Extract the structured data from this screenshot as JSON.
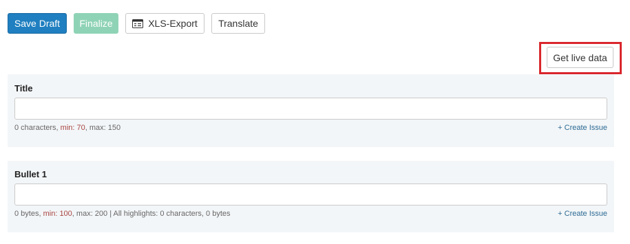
{
  "toolbar": {
    "save_draft_label": "Save Draft",
    "finalize_label": "Finalize",
    "xls_export_label": "XLS-Export",
    "translate_label": "Translate"
  },
  "live_data": {
    "label": "Get live data"
  },
  "fields": {
    "title": {
      "label": "Title",
      "value": "",
      "count_text": "0 characters,",
      "min_label": "min:",
      "min_value": "70",
      "max_text": ", max: 150",
      "create_issue_label": "+ Create Issue"
    },
    "bullet1": {
      "label": "Bullet 1",
      "value": "",
      "count_text": "0 bytes,",
      "min_label": "min:",
      "min_value": "100",
      "max_text": ", max: 200 | All highlights: 0 characters, 0 bytes",
      "create_issue_label": "+ Create Issue"
    }
  },
  "colors": {
    "primary": "#1f7fc0",
    "finalize_disabled": "#8fd3b6",
    "highlight_border": "#d9262c",
    "panel_bg": "#f3f6f8",
    "min_text": "#a94442",
    "link": "#2c6a94"
  },
  "icons": {
    "xls_export": "spreadsheet-export-icon"
  }
}
